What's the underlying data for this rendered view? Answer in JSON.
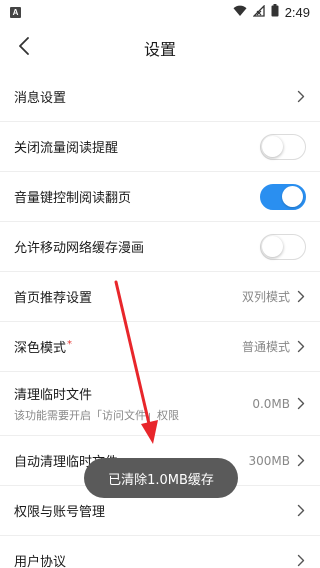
{
  "status_bar": {
    "notification_icon": "A",
    "time": "2:49",
    "icons": [
      "wifi-icon",
      "signal-icon",
      "battery-icon"
    ]
  },
  "header": {
    "title": "设置",
    "back_icon": "chevron-left-icon"
  },
  "settings": {
    "message_settings": {
      "label": "消息设置"
    },
    "close_data_reading_reminder": {
      "label": "关闭流量阅读提醒",
      "enabled": false
    },
    "volume_key_page_turn": {
      "label": "音量键控制阅读翻页",
      "enabled": true
    },
    "allow_mobile_cache_comics": {
      "label": "允许移动网络缓存漫画",
      "enabled": false
    },
    "homepage_recommend": {
      "label": "首页推荐设置",
      "value": "双列模式"
    },
    "dark_mode": {
      "label": "深色模式",
      "marker": "*",
      "value": "普通模式"
    },
    "clear_temp_files": {
      "label": "清理临时文件",
      "description": "该功能需要开启「访问文件」权限",
      "value": "0.0MB"
    },
    "auto_clear_temp_files": {
      "label": "自动清理临时文件",
      "value": "300MB"
    },
    "permissions_account": {
      "label": "权限与账号管理"
    },
    "user_agreement": {
      "label": "用户协议"
    }
  },
  "toast": {
    "message": "已清除1.0MB缓存"
  },
  "colors": {
    "accent": "#2a8ff0",
    "annotation_arrow": "#e8262b",
    "toast_bg": "#5a5a5a",
    "divider": "#eeeeee"
  }
}
